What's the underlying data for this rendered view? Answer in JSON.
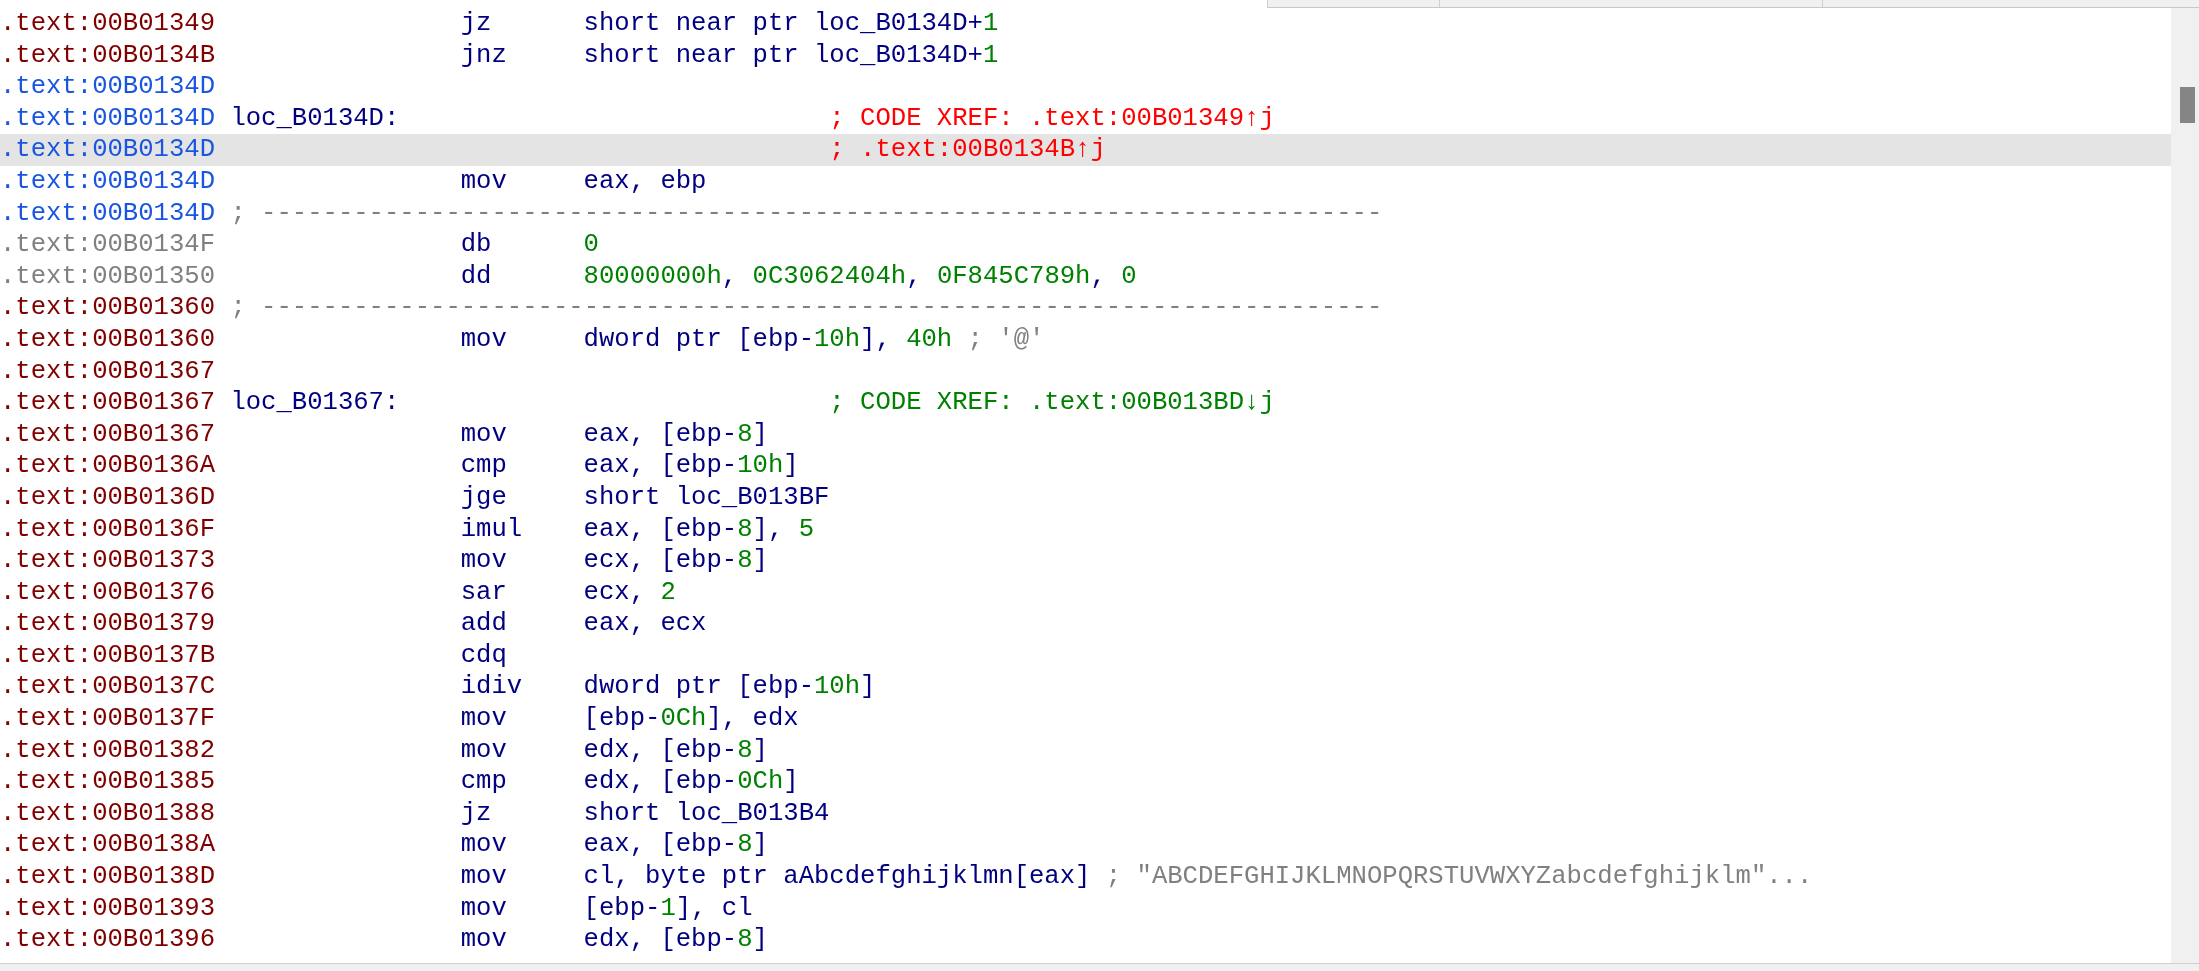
{
  "lines": [
    {
      "kind": "insn",
      "address": ".text:00B01349",
      "color": "#800000",
      "mnemonic": "jz",
      "operands": [
        {
          "text": "short near ptr loc_B0134D+",
          "kind": "plain"
        },
        {
          "text": "1",
          "kind": "number"
        }
      ],
      "selected": false
    },
    {
      "kind": "insn",
      "address": ".text:00B0134B",
      "color": "#800000",
      "mnemonic": "jnz",
      "operands": [
        {
          "text": "short near ptr loc_B0134D+",
          "kind": "plain"
        },
        {
          "text": "1",
          "kind": "number"
        }
      ],
      "selected": false
    },
    {
      "kind": "insn",
      "address": ".text:00B0134D",
      "color": "#1a55e0",
      "selected": false
    },
    {
      "kind": "insn",
      "address": ".text:00B0134D",
      "color": "#1a55e0",
      "label": "loc_B0134D:",
      "comment": {
        "text": "; CODE XREF: .text:00B01349↑j",
        "kind": "bad_xref"
      },
      "selected": false
    },
    {
      "kind": "insn",
      "address": ".text:00B0134D",
      "color": "#1a55e0",
      "comment": {
        "text": "; .text:00B0134B↑j",
        "kind": "bad_xref"
      },
      "selected": true
    },
    {
      "kind": "insn",
      "address": ".text:00B0134D",
      "color": "#1a55e0",
      "mnemonic": "mov",
      "operands": [
        {
          "text": "eax, ebp",
          "kind": "plain"
        }
      ],
      "selected": false
    },
    {
      "kind": "separator",
      "address": ".text:00B0134D",
      "color": "#1a55e0",
      "text": "; -------------------------------------------------------------------------",
      "selected": false
    },
    {
      "kind": "insn",
      "address": ".text:00B0134F",
      "color": "#808080",
      "mnemonic": "db",
      "operands": [
        {
          "text": "0",
          "kind": "number"
        }
      ],
      "selected": false
    },
    {
      "kind": "insn",
      "address": ".text:00B01350",
      "color": "#808080",
      "mnemonic": "dd",
      "operands": [
        {
          "text": "80000000h",
          "kind": "number"
        },
        {
          "text": ", ",
          "kind": "plain"
        },
        {
          "text": "0C3062404h",
          "kind": "number"
        },
        {
          "text": ", ",
          "kind": "plain"
        },
        {
          "text": "0F845C789h",
          "kind": "number"
        },
        {
          "text": ", ",
          "kind": "plain"
        },
        {
          "text": "0",
          "kind": "number"
        }
      ],
      "selected": false
    },
    {
      "kind": "separator",
      "address": ".text:00B01360",
      "color": "#800000",
      "text": "; -------------------------------------------------------------------------",
      "selected": false
    },
    {
      "kind": "insn",
      "address": ".text:00B01360",
      "color": "#800000",
      "mnemonic": "mov",
      "operands": [
        {
          "text": "dword ptr [ebp-",
          "kind": "plain"
        },
        {
          "text": "10h",
          "kind": "number"
        },
        {
          "text": "], ",
          "kind": "plain"
        },
        {
          "text": "40h",
          "kind": "number"
        },
        {
          "text": " ; '@'",
          "kind": "string"
        }
      ],
      "selected": false
    },
    {
      "kind": "insn",
      "address": ".text:00B01367",
      "color": "#800000",
      "selected": false
    },
    {
      "kind": "insn",
      "address": ".text:00B01367",
      "color": "#800000",
      "label": "loc_B01367:",
      "comment": {
        "text": "; CODE XREF: .text:00B013BD↓j",
        "kind": "xref"
      },
      "selected": false
    },
    {
      "kind": "insn",
      "address": ".text:00B01367",
      "color": "#800000",
      "mnemonic": "mov",
      "operands": [
        {
          "text": "eax, [ebp-",
          "kind": "plain"
        },
        {
          "text": "8",
          "kind": "number"
        },
        {
          "text": "]",
          "kind": "plain"
        }
      ],
      "selected": false
    },
    {
      "kind": "insn",
      "address": ".text:00B0136A",
      "color": "#800000",
      "mnemonic": "cmp",
      "operands": [
        {
          "text": "eax, [ebp-",
          "kind": "plain"
        },
        {
          "text": "10h",
          "kind": "number"
        },
        {
          "text": "]",
          "kind": "plain"
        }
      ],
      "selected": false
    },
    {
      "kind": "insn",
      "address": ".text:00B0136D",
      "color": "#800000",
      "mnemonic": "jge",
      "operands": [
        {
          "text": "short loc_B013BF",
          "kind": "plain"
        }
      ],
      "selected": false
    },
    {
      "kind": "insn",
      "address": ".text:00B0136F",
      "color": "#800000",
      "mnemonic": "imul",
      "operands": [
        {
          "text": "eax, [ebp-",
          "kind": "plain"
        },
        {
          "text": "8",
          "kind": "number"
        },
        {
          "text": "], ",
          "kind": "plain"
        },
        {
          "text": "5",
          "kind": "number"
        }
      ],
      "selected": false
    },
    {
      "kind": "insn",
      "address": ".text:00B01373",
      "color": "#800000",
      "mnemonic": "mov",
      "operands": [
        {
          "text": "ecx, [ebp-",
          "kind": "plain"
        },
        {
          "text": "8",
          "kind": "number"
        },
        {
          "text": "]",
          "kind": "plain"
        }
      ],
      "selected": false
    },
    {
      "kind": "insn",
      "address": ".text:00B01376",
      "color": "#800000",
      "mnemonic": "sar",
      "operands": [
        {
          "text": "ecx, ",
          "kind": "plain"
        },
        {
          "text": "2",
          "kind": "number"
        }
      ],
      "selected": false
    },
    {
      "kind": "insn",
      "address": ".text:00B01379",
      "color": "#800000",
      "mnemonic": "add",
      "operands": [
        {
          "text": "eax, ecx",
          "kind": "plain"
        }
      ],
      "selected": false
    },
    {
      "kind": "insn",
      "address": ".text:00B0137B",
      "color": "#800000",
      "mnemonic": "cdq",
      "selected": false
    },
    {
      "kind": "insn",
      "address": ".text:00B0137C",
      "color": "#800000",
      "mnemonic": "idiv",
      "operands": [
        {
          "text": "dword ptr [ebp-",
          "kind": "plain"
        },
        {
          "text": "10h",
          "kind": "number"
        },
        {
          "text": "]",
          "kind": "plain"
        }
      ],
      "selected": false
    },
    {
      "kind": "insn",
      "address": ".text:00B0137F",
      "color": "#800000",
      "mnemonic": "mov",
      "operands": [
        {
          "text": "[ebp-",
          "kind": "plain"
        },
        {
          "text": "0Ch",
          "kind": "number"
        },
        {
          "text": "], edx",
          "kind": "plain"
        }
      ],
      "selected": false
    },
    {
      "kind": "insn",
      "address": ".text:00B01382",
      "color": "#800000",
      "mnemonic": "mov",
      "operands": [
        {
          "text": "edx, [ebp-",
          "kind": "plain"
        },
        {
          "text": "8",
          "kind": "number"
        },
        {
          "text": "]",
          "kind": "plain"
        }
      ],
      "selected": false
    },
    {
      "kind": "insn",
      "address": ".text:00B01385",
      "color": "#800000",
      "mnemonic": "cmp",
      "operands": [
        {
          "text": "edx, [ebp-",
          "kind": "plain"
        },
        {
          "text": "0Ch",
          "kind": "number"
        },
        {
          "text": "]",
          "kind": "plain"
        }
      ],
      "selected": false
    },
    {
      "kind": "insn",
      "address": ".text:00B01388",
      "color": "#800000",
      "mnemonic": "jz",
      "operands": [
        {
          "text": "short loc_B013B4",
          "kind": "plain"
        }
      ],
      "selected": false
    },
    {
      "kind": "insn",
      "address": ".text:00B0138A",
      "color": "#800000",
      "mnemonic": "mov",
      "operands": [
        {
          "text": "eax, [ebp-",
          "kind": "plain"
        },
        {
          "text": "8",
          "kind": "number"
        },
        {
          "text": "]",
          "kind": "plain"
        }
      ],
      "selected": false
    },
    {
      "kind": "insn",
      "address": ".text:00B0138D",
      "color": "#800000",
      "mnemonic": "mov",
      "operands": [
        {
          "text": "cl, byte ptr aAbcdefghijklmn[eax]",
          "kind": "plain"
        },
        {
          "text": " ; \"ABCDEFGHIJKLMNOPQRSTUVWXYZabcdefghijklm\"...",
          "kind": "string"
        }
      ],
      "selected": false
    },
    {
      "kind": "insn",
      "address": ".text:00B01393",
      "color": "#800000",
      "mnemonic": "mov",
      "operands": [
        {
          "text": "[ebp-",
          "kind": "plain"
        },
        {
          "text": "1",
          "kind": "number"
        },
        {
          "text": "], cl",
          "kind": "plain"
        }
      ],
      "selected": false
    },
    {
      "kind": "insn",
      "address": ".text:00B01396",
      "color": "#800000",
      "mnemonic": "mov",
      "operands": [
        {
          "text": "edx, [ebp-",
          "kind": "plain"
        },
        {
          "text": "8",
          "kind": "number"
        },
        {
          "text": "]",
          "kind": "plain"
        }
      ],
      "selected": false
    }
  ]
}
